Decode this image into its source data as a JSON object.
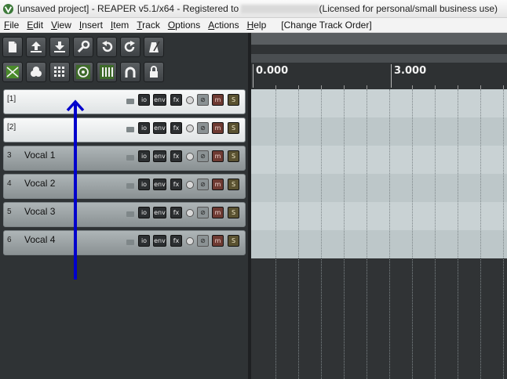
{
  "window": {
    "title_prefix": "[unsaved project] - REAPER v5.1/x64 - Registered to",
    "license_text": "(Licensed for personal/small business use)"
  },
  "menu": {
    "items": [
      {
        "underline": "F",
        "rest": "ile"
      },
      {
        "underline": "E",
        "rest": "dit"
      },
      {
        "underline": "V",
        "rest": "iew"
      },
      {
        "underline": "I",
        "rest": "nsert"
      },
      {
        "underline": "I",
        "rest": "tem"
      },
      {
        "underline": "T",
        "rest": "rack"
      },
      {
        "underline": "O",
        "rest": "ptions"
      },
      {
        "underline": "A",
        "rest": "ctions"
      },
      {
        "underline": "H",
        "rest": "elp"
      }
    ],
    "extra": "[Change Track Order]"
  },
  "toolbar": {
    "icons": [
      "new-project-icon",
      "open-project-icon",
      "save-project-icon",
      "project-settings-icon",
      "undo-icon",
      "redo-icon",
      "metronome-icon",
      "auto-crossfade-icon",
      "ripple-edit-icon",
      "grid-icon",
      "snap-icon",
      "track-grouping-icon",
      "locking-icon",
      "lock-icon"
    ]
  },
  "tracks": [
    {
      "num": "[1]",
      "name": "",
      "style": "light"
    },
    {
      "num": "[2]",
      "name": "",
      "style": "light"
    },
    {
      "num": "3",
      "name": "Vocal 1",
      "style": "dark"
    },
    {
      "num": "4",
      "name": "Vocal 2",
      "style": "dark"
    },
    {
      "num": "5",
      "name": "Vocal 3",
      "style": "dark"
    },
    {
      "num": "6",
      "name": "Vocal 4",
      "style": "dark"
    }
  ],
  "track_buttons": {
    "io": "io",
    "env": "env",
    "fx": "fx",
    "mute": "m",
    "solo": "S"
  },
  "ruler": {
    "labels": [
      "0.000",
      "3.000"
    ]
  },
  "colors": {
    "arrow": "#0000cc",
    "mute": "#6e3a32",
    "solo": "#5a5231"
  }
}
